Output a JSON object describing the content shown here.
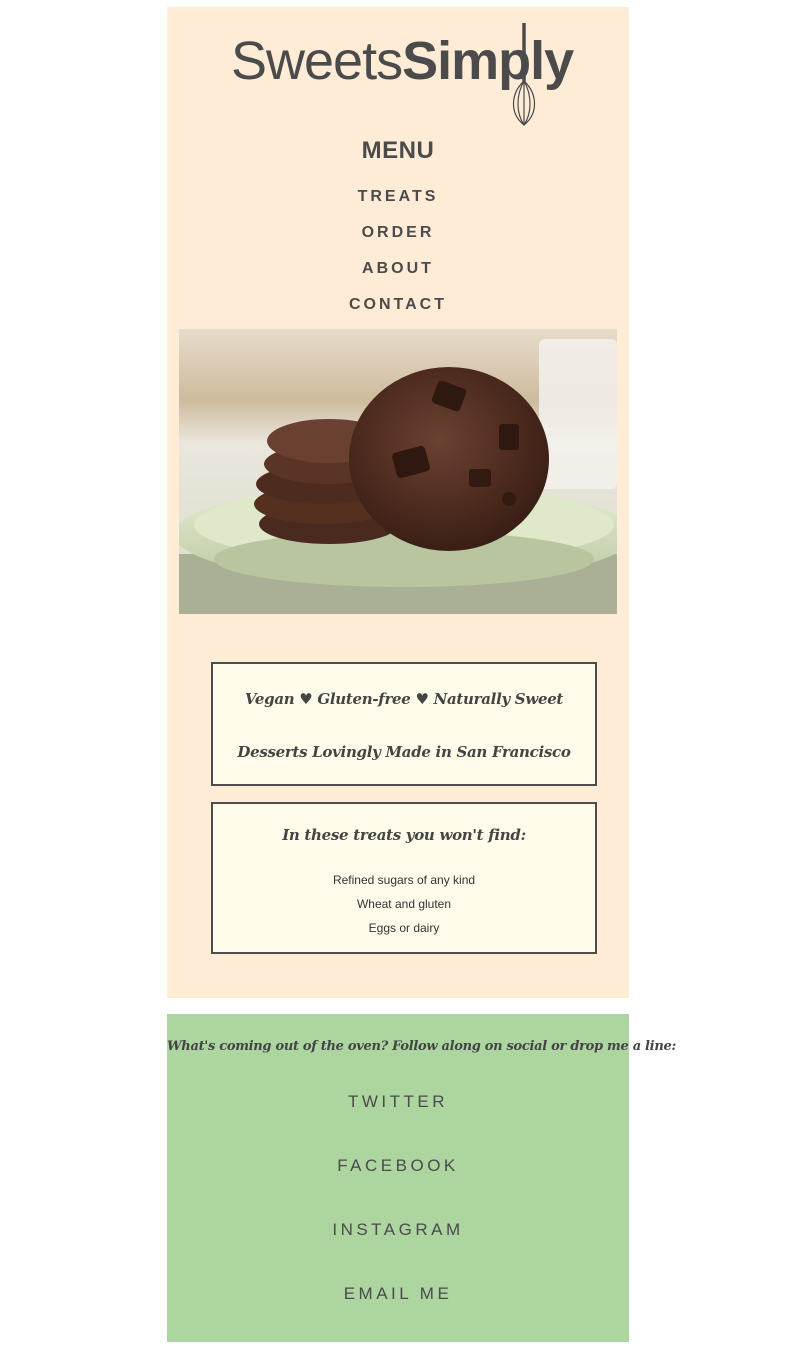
{
  "brand": {
    "name_light": "Sweets",
    "name_bold": "Simply"
  },
  "menu": {
    "title": "MENU",
    "items": [
      "TREATS",
      "ORDER",
      "ABOUT",
      "CONTACT"
    ]
  },
  "hero": {
    "image": "chocolate-cookies-photo"
  },
  "tagline": {
    "part1": "Vegan",
    "part2": "Gluten-free",
    "part3": "Naturally Sweet",
    "separator": "♥",
    "line2": "Desserts Lovingly Made in San Francisco"
  },
  "free_from": {
    "heading": "In these treats you won't find:",
    "items": [
      "Refined sugars of any kind",
      "Wheat and gluten",
      "Eggs or dairy"
    ]
  },
  "footer": {
    "tagline": "What's coming out of the oven? Follow along on social or drop me a line:",
    "links": [
      "TWITTER",
      "FACEBOOK",
      "INSTAGRAM",
      "EMAIL ME"
    ]
  },
  "colors": {
    "main_bg": "#feecd6",
    "box_bg": "#fffbeb",
    "footer_bg": "#acd5a0",
    "text": "#4b4b4b"
  }
}
